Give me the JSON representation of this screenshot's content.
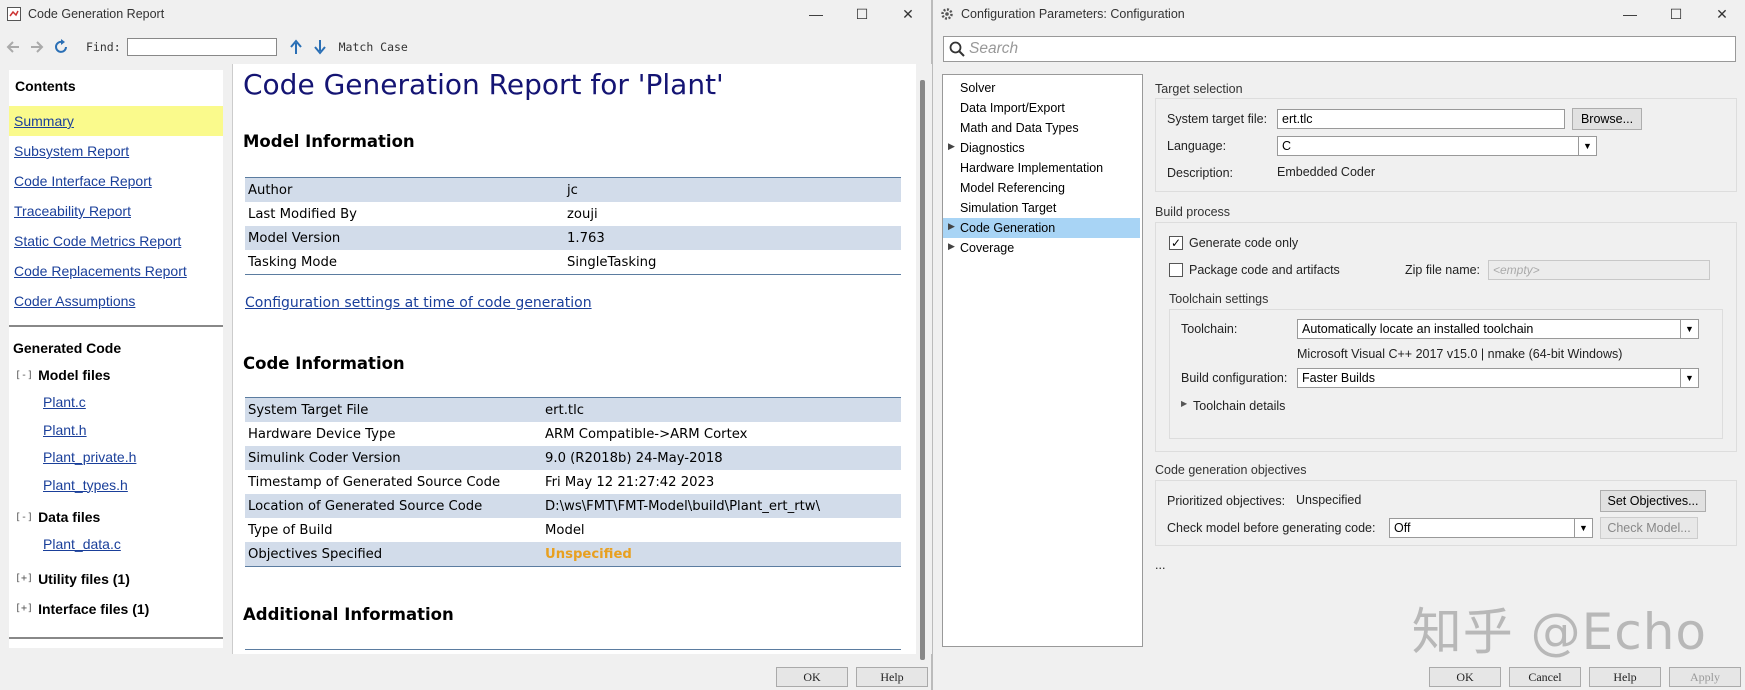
{
  "report_window": {
    "title": "Code Generation Report",
    "toolbar": {
      "find_label": "Find:",
      "find_value": "",
      "match_case_label": "Match Case"
    },
    "contents": {
      "heading": "Contents",
      "links": [
        "Summary",
        "Subsystem Report",
        "Code Interface Report",
        "Traceability Report",
        "Static Code Metrics Report",
        "Code Replacements Report",
        "Coder Assumptions"
      ],
      "generated_code_heading": "Generated Code",
      "model_files": {
        "toggle": "[-]",
        "label": "Model files",
        "files": [
          "Plant.c",
          "Plant.h",
          "Plant_private.h",
          "Plant_types.h"
        ]
      },
      "data_files": {
        "toggle": "[-]",
        "label": "Data files",
        "files": [
          "Plant_data.c"
        ]
      },
      "utility_files": {
        "toggle": "[+]",
        "label": "Utility files (1)"
      },
      "interface_files": {
        "toggle": "[+]",
        "label": "Interface files (1)"
      }
    },
    "report": {
      "title": "Code Generation Report for 'Plant'",
      "model_info_heading": "Model Information",
      "model_info": [
        {
          "k": "Author",
          "v": "jc"
        },
        {
          "k": "Last Modified By",
          "v": "zouji"
        },
        {
          "k": "Model Version",
          "v": "1.763"
        },
        {
          "k": "Tasking Mode",
          "v": "SingleTasking"
        }
      ],
      "config_link": "Configuration settings at time of code generation",
      "code_info_heading": "Code Information",
      "code_info": [
        {
          "k": "System Target File",
          "v": "ert.tlc"
        },
        {
          "k": "Hardware Device Type",
          "v": "ARM Compatible->ARM Cortex"
        },
        {
          "k": "Simulink Coder Version",
          "v": "9.0 (R2018b) 24-May-2018"
        },
        {
          "k": "Timestamp of Generated Source Code",
          "v": "Fri May 12 21:27:42 2023"
        },
        {
          "k": "Location of Generated Source Code",
          "v": "D:\\ws\\FMT\\FMT-Model\\build\\Plant_ert_rtw\\"
        },
        {
          "k": "Type of Build",
          "v": "Model"
        },
        {
          "k": "Objectives Specified",
          "v": "Unspecified"
        }
      ],
      "additional_info_heading": "Additional Information"
    },
    "buttons": {
      "ok": "OK",
      "help": "Help"
    }
  },
  "config_window": {
    "title": "Configuration Parameters: Configuration",
    "search_placeholder": "Search",
    "tree": [
      {
        "label": "Solver",
        "arrow": false
      },
      {
        "label": "Data Import/Export",
        "arrow": false
      },
      {
        "label": "Math and Data Types",
        "arrow": false
      },
      {
        "label": "Diagnostics",
        "arrow": true
      },
      {
        "label": "Hardware Implementation",
        "arrow": false
      },
      {
        "label": "Model Referencing",
        "arrow": false
      },
      {
        "label": "Simulation Target",
        "arrow": false
      },
      {
        "label": "Code Generation",
        "arrow": true,
        "selected": true
      },
      {
        "label": "Coverage",
        "arrow": true
      }
    ],
    "target_selection": {
      "title": "Target selection",
      "stf_label": "System target file:",
      "stf_value": "ert.tlc",
      "browse": "Browse...",
      "language_label": "Language:",
      "language_value": "C",
      "description_label": "Description:",
      "description_value": "Embedded Coder"
    },
    "build_process": {
      "title": "Build process",
      "generate_only": "Generate code only",
      "generate_only_checked": true,
      "package": "Package code and artifacts",
      "package_checked": false,
      "zip_label": "Zip file name:",
      "zip_placeholder": "<empty>",
      "toolchain_settings_title": "Toolchain settings",
      "toolchain_label": "Toolchain:",
      "toolchain_value": "Automatically locate an installed toolchain",
      "toolchain_info": "Microsoft Visual C++ 2017 v15.0 | nmake (64-bit Windows)",
      "build_config_label": "Build configuration:",
      "build_config_value": "Faster Builds",
      "toolchain_details": "Toolchain details"
    },
    "objectives": {
      "title": "Code generation objectives",
      "prioritized_label": "Prioritized objectives:",
      "prioritized_value": "Unspecified",
      "set_objectives": "Set Objectives...",
      "check_label": "Check model before generating code:",
      "check_value": "Off",
      "check_model": "Check Model..."
    },
    "ellipsis": "...",
    "buttons": {
      "ok": "OK",
      "cancel": "Cancel",
      "help": "Help",
      "apply": "Apply"
    },
    "watermark": "知乎 @Echo"
  },
  "colors": {
    "link": "#1a3f9a",
    "highlight": "#fafa8c",
    "table_stripe": "#d2dcea",
    "unspecified": "#e8a020",
    "tree_selected": "#a8d4f5",
    "report_title": "#141473"
  }
}
